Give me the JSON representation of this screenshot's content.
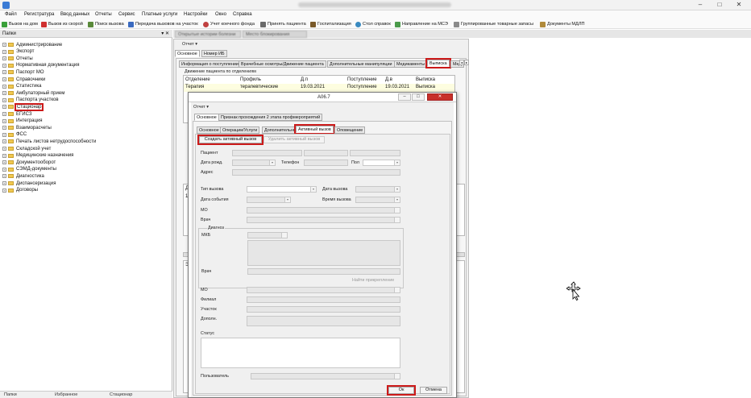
{
  "titlebar": {
    "controls": [
      "–",
      "□",
      "✕"
    ]
  },
  "menu": [
    "Файл",
    "Регистратура",
    "Ввод данных",
    "Отчеты",
    "Сервис",
    "Платные услуги",
    "Настройки",
    "Окно",
    "Справка"
  ],
  "toolbar": [
    "Вызов на дом",
    "Вызов из скорой",
    "Поиск вызова",
    "Передача вызовов на участок",
    "Учет коечного фонда",
    "Принять пациента",
    "Госпитализация",
    "Стол справок",
    "Направление на МСЭ",
    "Группированные товарные запасы",
    "Документы МДЛП"
  ],
  "left_panel": {
    "title": "Папки",
    "pin": "▾ ✕",
    "tree": [
      "Администрирование",
      "Экспорт",
      "Отчеты",
      "Нормативная документация",
      "Паспорт МО",
      "Справочники",
      "Статистика",
      "Амбулаторный прием",
      "Паспорта участков",
      "Стационар",
      "ЕГИСЗ",
      "Интеграция",
      "Взаиморасчеты",
      "ФСС",
      "Печать листов нетрудоспособности",
      "Складской учет",
      "Медицинские назначения",
      "Документооборот",
      "СЭМД-документы",
      "Диагностика",
      "Диспансеризация",
      "Договоры"
    ],
    "bottom_tabs": [
      "Папки",
      "Избранное",
      "Стационар"
    ]
  },
  "doc_tabs": [
    "Открытые истории болезни",
    "Место блокирования"
  ],
  "main": {
    "report": "Отчет ▾",
    "tabs": [
      "Основное",
      "Номер ИБ"
    ],
    "subtabs": [
      "Информация о поступлении",
      "Врачебные осмотры/Движение пациента",
      "Дополнительные манипуляции",
      "Медикаменты",
      "Выписка",
      "Мед"
    ],
    "nav": [
      "◂",
      "▸"
    ],
    "group_title": "Движение пациента по отделениям",
    "columns": [
      "Отделение",
      "Профиль",
      "Д.п",
      "Поступление",
      "Д.в",
      "Выписка"
    ],
    "row": [
      "Терапия",
      "терапевтические",
      "19.03.2021",
      "Поступление",
      "19.03.2021",
      "Выписка"
    ],
    "lower_labels": [
      "Д",
      "19",
      "Эп",
      "В"
    ]
  },
  "dialog": {
    "title": "А06.7",
    "controls": [
      "–",
      "□",
      "✕"
    ],
    "report": "Отчет ▾",
    "tabs": [
      "Основное",
      "Признак прохождения 2 этапа профмероприятий"
    ],
    "subtabs": [
      "Основное",
      "Операции/Услуги",
      "Дополнительно",
      "Активный вызов",
      "Оповещение"
    ],
    "create_btn": "Создать активный вызов",
    "delete_btn": "Удалить активный вызов",
    "labels": {
      "patient": "Пациент",
      "dob": "Дата рожд.",
      "phone": "Телефон",
      "sex": "Пол",
      "address": "Адрес",
      "call_type": "Тип вызова",
      "call_date": "Дата вызова",
      "event_date": "Дата события",
      "call_time": "Время вызова",
      "mo": "МО",
      "doctor": "Врач",
      "diag_group": "Диагноз",
      "mkb": "МКБ",
      "doctor2": "Врач",
      "find_att": "Найти прикрепление",
      "mo2": "МО",
      "branch": "Филиал",
      "site": "Участок",
      "extra": "Дополн.",
      "status": "Статус",
      "user": "Пользователь"
    },
    "ok": "Ок",
    "cancel": "Отмена"
  },
  "colors": {
    "highlight": "#cc1a1a",
    "panel": "#f0f0f0",
    "accent": "#3a7bd5"
  }
}
